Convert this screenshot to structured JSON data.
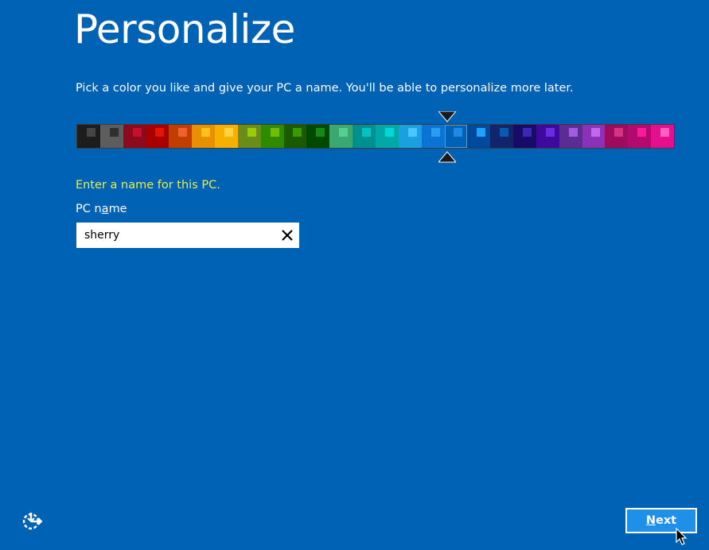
{
  "header": {
    "title": "Personalize",
    "subtitle": "Pick a color you like and give your PC a name. You'll be able to personalize more later."
  },
  "palette": {
    "selected_index": 16,
    "swatches": [
      {
        "bg": "#1d1d1d",
        "accent": "#464646"
      },
      {
        "bg": "#5d5d5d",
        "accent": "#2f2f2f"
      },
      {
        "bg": "#8c0a1e",
        "accent": "#c8102e"
      },
      {
        "bg": "#a80000",
        "accent": "#e51400"
      },
      {
        "bg": "#c13e00",
        "accent": "#f0622d"
      },
      {
        "bg": "#e89100",
        "accent": "#ffc21a"
      },
      {
        "bg": "#f7b000",
        "accent": "#ffd43d"
      },
      {
        "bg": "#6c8c1a",
        "accent": "#9acd00"
      },
      {
        "bg": "#2f8a00",
        "accent": "#6dbf00"
      },
      {
        "bg": "#1c5a00",
        "accent": "#3a9a00"
      },
      {
        "bg": "#004a00",
        "accent": "#128c12"
      },
      {
        "bg": "#3ba872",
        "accent": "#54d18e"
      },
      {
        "bg": "#009090",
        "accent": "#00c5c5"
      },
      {
        "bg": "#00a8a8",
        "accent": "#00d8d8"
      },
      {
        "bg": "#1a9fe0",
        "accent": "#4cc4ff"
      },
      {
        "bg": "#0a73d4",
        "accent": "#2c9cf2"
      },
      {
        "bg": "#0062b5",
        "accent": "#1e8ae6"
      },
      {
        "bg": "#004a9e",
        "accent": "#1ba4ff"
      },
      {
        "bg": "#12256b",
        "accent": "#0a5ab4"
      },
      {
        "bg": "#180a68",
        "accent": "#3d27b8"
      },
      {
        "bg": "#3d0a9c",
        "accent": "#6a2ce0"
      },
      {
        "bg": "#5c2d91",
        "accent": "#a35be0"
      },
      {
        "bg": "#8a33b8",
        "accent": "#c667f0"
      },
      {
        "bg": "#9e0a5e",
        "accent": "#d63385"
      },
      {
        "bg": "#b20a6e",
        "accent": "#ff1a9c"
      },
      {
        "bg": "#e30f8c",
        "accent": "#ff5fc2"
      }
    ]
  },
  "form": {
    "prompt": "Enter a name for this PC.",
    "label_before": "PC n",
    "label_underlined": "a",
    "label_after": "me",
    "value": "sherry"
  },
  "footer": {
    "next_prefix": "",
    "next_underlined": "N",
    "next_suffix": "ext"
  },
  "icons": {
    "clear": "close-icon",
    "ease_of_access": "ease-of-access-icon",
    "cursor": "mouse-pointer-icon"
  },
  "colors": {
    "background": "#0062b5",
    "prompt": "#e6f04a",
    "next_button": "#1f90ea"
  }
}
